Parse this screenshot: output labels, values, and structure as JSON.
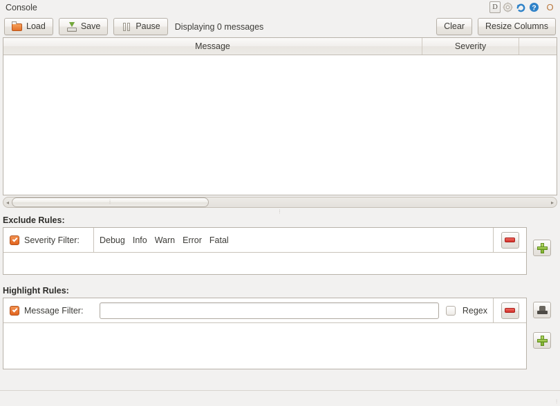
{
  "window": {
    "title": "Console",
    "title_icons": [
      {
        "name": "dock-icon",
        "glyph": "D"
      },
      {
        "name": "gear-icon",
        "glyph": "⚙"
      },
      {
        "name": "refresh-icon",
        "glyph": "↻"
      },
      {
        "name": "help-icon",
        "glyph": "?"
      },
      {
        "name": "circle-icon",
        "glyph": "O"
      }
    ]
  },
  "toolbar": {
    "load_label": "Load",
    "save_label": "Save",
    "pause_label": "Pause",
    "status_text": "Displaying 0 messages",
    "clear_label": "Clear",
    "resize_columns_label": "Resize Columns"
  },
  "table": {
    "columns": [
      "Message",
      "Severity"
    ],
    "rows": []
  },
  "scrollbar": {
    "left_arrow": "◂",
    "right_arrow": "▸",
    "grip": "⦙"
  },
  "splitter": {
    "grip": "⦙"
  },
  "exclude_rules": {
    "section_label": "Exclude Rules:",
    "rule": {
      "enabled": true,
      "label": "Severity Filter:",
      "severities": [
        "Debug",
        "Info",
        "Warn",
        "Error",
        "Fatal"
      ]
    },
    "remove_button_title": "Remove rule",
    "add_button_title": "Add rule"
  },
  "highlight_rules": {
    "section_label": "Highlight Rules:",
    "rule": {
      "enabled": true,
      "label": "Message Filter:",
      "value": "",
      "placeholder": "",
      "regex_label": "Regex",
      "regex_checked": false
    },
    "remove_button_title": "Remove rule",
    "style_button_title": "Style",
    "add_button_title": "Add rule"
  },
  "statusbar": {
    "grip": "⦙"
  },
  "colors": {
    "background": "#f2f1f0",
    "accent_check": "#e2641f",
    "remove": "#d3302a",
    "add": "#7fb02e"
  }
}
